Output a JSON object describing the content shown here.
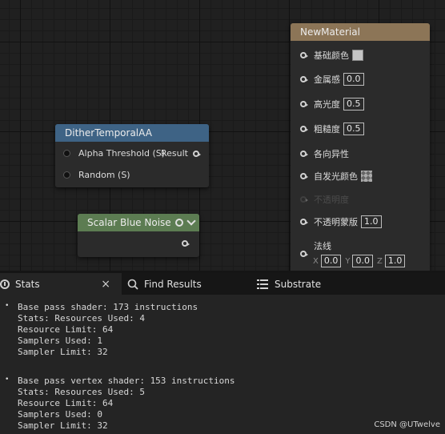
{
  "graph": {
    "dither_node": {
      "title": "DitherTemporalAA",
      "input1": "Alpha Threshold (S)",
      "output1": "Result",
      "input2": "Random (S)"
    },
    "scalar_node": {
      "title": "Scalar Blue Noise"
    },
    "material_node": {
      "title": "NewMaterial",
      "pins": [
        {
          "label": "基础颜色"
        },
        {
          "label": "金属感",
          "value": "0.0"
        },
        {
          "label": "高光度",
          "value": "0.5"
        },
        {
          "label": "粗糙度",
          "value": "0.5"
        },
        {
          "label": "各向异性"
        },
        {
          "label": "自发光颜色"
        },
        {
          "label": "不透明度"
        },
        {
          "label": "不透明蒙版",
          "value": "1.0"
        },
        {
          "label": "法线",
          "x_label": "X",
          "x": "0.0",
          "y_label": "Y",
          "y": "0.0",
          "z_label": "Z",
          "z": "1.0"
        }
      ]
    }
  },
  "tabs": [
    {
      "label": "Stats",
      "icon": "stats-icon",
      "active": true
    },
    {
      "label": "Find Results",
      "icon": "search-icon"
    },
    {
      "label": "Substrate",
      "icon": "list-icon"
    }
  ],
  "close_symbol": "×",
  "stats": {
    "blocks": [
      {
        "bullet": "•",
        "lines": [
          "Base pass shader: 173 instructions",
          "Stats: Resources Used: 4",
          "Resource Limit: 64",
          "Samplers Used: 1",
          "Sampler Limit: 32"
        ]
      },
      {
        "bullet": "•",
        "lines": [
          "Base pass vertex shader: 153 instructions",
          "Stats: Resources Used: 5",
          "Resource Limit: 64",
          "Samplers Used: 0",
          "Sampler Limit: 32"
        ]
      }
    ]
  },
  "watermark": "CSDN @UTwelve",
  "colors": {
    "dither_header": "#3e6385",
    "scalar_header": "#5c7c52",
    "material_header": "#8c7557",
    "graph_bg": "#202020",
    "panel_bg": "#242424"
  }
}
